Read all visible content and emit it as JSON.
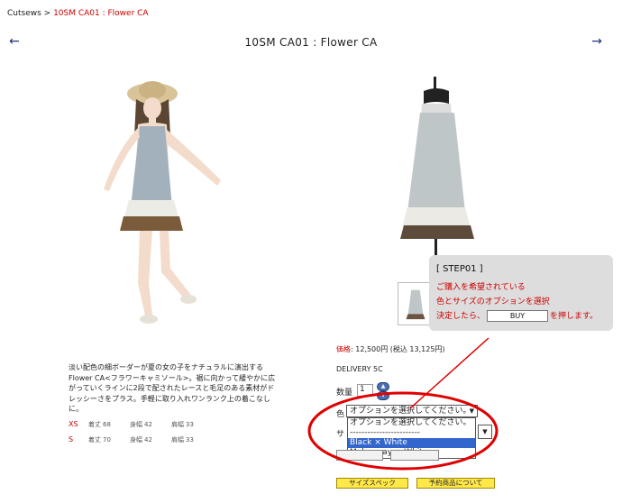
{
  "breadcrumb": {
    "parent": "Cutsews",
    "separator": " > ",
    "current": "10SM CA01 : Flower CA"
  },
  "nav": {
    "prev": "←",
    "next": "→"
  },
  "product": {
    "title": "10SM CA01 : Flower CA",
    "description": "淡い配色の細ボーダーが夏の女の子をナチュラルに演出するFlower CA<フラワーキャミソール>。裾に向かって緩やかに広がっていくラインに2段で配されたレースと毛足のある素材がドレッシーさをプラス。手軽に取り入れワンランク上の着こなしに。",
    "sizes": [
      {
        "size": "XS",
        "k1": "着丈",
        "v1": "68",
        "k2": "身幅",
        "v2": "42",
        "k3": "肩幅",
        "v3": "33"
      },
      {
        "size": "S",
        "k1": "着丈",
        "v1": "70",
        "k2": "身幅",
        "v2": "42",
        "k3": "肩幅",
        "v3": "33"
      }
    ],
    "price_label": "価格",
    "price_value": ": 12,500円 (税込 13,125円)",
    "delivery": "DELIVERY 5C"
  },
  "form": {
    "qty_label": "数量",
    "qty_value": "1",
    "color_label": "色",
    "color_selected": "オプションを選択してください。",
    "color_options": [
      "オプションを選択してください。",
      "------------------------",
      "Black × White",
      "Moku gray × White"
    ],
    "size_label": "サ"
  },
  "buttons": {
    "size_spec": "サイズスペック",
    "reservation": "予約商品について"
  },
  "callout": {
    "title": "[ STEP01 ]",
    "line1": "ご購入を希望されている",
    "line2": "色とサイズのオプションを選択",
    "line3_pre": "決定したら、",
    "buy": "BUY",
    "line3_post": "を押します。"
  },
  "colors": {
    "accent_red": "#cc0000",
    "callout_bg": "#dddddd",
    "button_yellow": "#ffe84a",
    "highlight_blue": "#3366cc"
  }
}
